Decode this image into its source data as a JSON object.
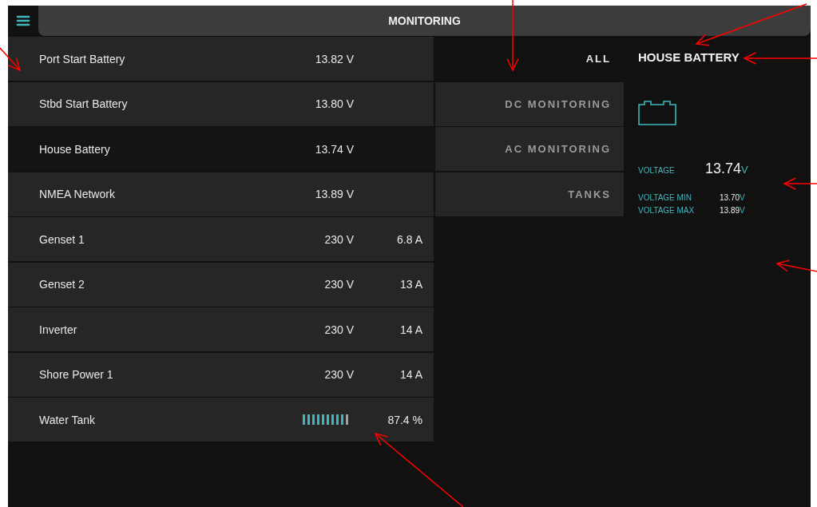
{
  "header": {
    "title": "MONITORING"
  },
  "devices": [
    {
      "kind": "reading",
      "name": "Port Start Battery",
      "voltage": "13.82 V",
      "selected": false
    },
    {
      "kind": "reading",
      "name": "Stbd Start Battery",
      "voltage": "13.80 V",
      "selected": false
    },
    {
      "kind": "reading",
      "name": "House Battery",
      "voltage": "13.74 V",
      "selected": true
    },
    {
      "kind": "reading",
      "name": "NMEA Network",
      "voltage": "13.89 V",
      "selected": false
    },
    {
      "kind": "reading",
      "name": "Genset 1",
      "voltage": "230 V",
      "current": "6.8 A",
      "selected": false
    },
    {
      "kind": "reading",
      "name": "Genset 2",
      "voltage": "230 V",
      "current": "13 A",
      "selected": false
    },
    {
      "kind": "reading",
      "name": "Inverter",
      "voltage": "230 V",
      "current": "14 A",
      "selected": false
    },
    {
      "kind": "reading",
      "name": "Shore Power 1",
      "voltage": "230 V",
      "current": "14 A",
      "selected": false
    },
    {
      "kind": "tank",
      "name": "Water Tank",
      "level": 0.874,
      "reading": "87.4 %",
      "selected": false
    }
  ],
  "categories": [
    {
      "label": "ALL",
      "selected": true
    },
    {
      "label": "DC MONITORING",
      "selected": false
    },
    {
      "label": "AC MONITORING",
      "selected": false
    },
    {
      "label": "TANKS",
      "selected": false
    }
  ],
  "detail": {
    "title": "HOUSE BATTERY",
    "voltage_label": "VOLTAGE",
    "voltage": "13.74",
    "voltage_unit": "V",
    "stats": [
      {
        "label": "VOLTAGE MIN",
        "value": "13.70",
        "unit": "V"
      },
      {
        "label": "VOLTAGE MAX",
        "value": "13.89",
        "unit": "V"
      }
    ]
  },
  "annotations": [
    {
      "kind": "arrow"
    },
    {
      "kind": "arrow"
    },
    {
      "kind": "arrow"
    },
    {
      "kind": "arrow"
    },
    {
      "kind": "arrow"
    },
    {
      "kind": "arrow"
    },
    {
      "kind": "arrow"
    }
  ]
}
